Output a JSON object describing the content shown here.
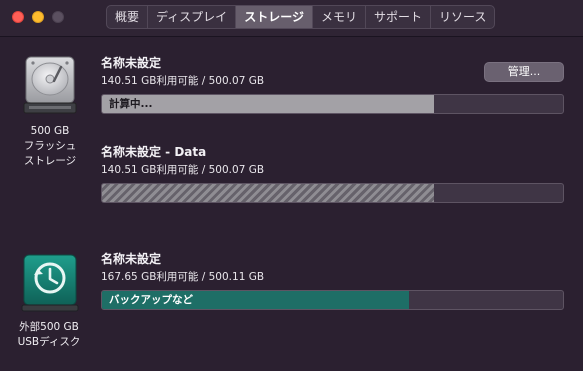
{
  "tabs": [
    "概要",
    "ディスプレイ",
    "ストレージ",
    "メモリ",
    "サポート",
    "リソース"
  ],
  "active_tab": "ストレージ",
  "internal_disk": {
    "caption_lines": [
      "500 GB",
      "フラッシュ",
      "ストレージ"
    ],
    "manage_button": "管理...",
    "volumes": [
      {
        "name": "名称未設定",
        "capacity": "140.51 GB利用可能 / 500.07 GB",
        "bar_label": "計算中...",
        "used_fraction": 0.72
      },
      {
        "name": "名称未設定 - Data",
        "capacity": "140.51 GB利用可能 / 500.07 GB",
        "bar_label": "",
        "used_fraction": 0.72
      }
    ]
  },
  "external_disk": {
    "caption_lines": [
      "外部500 GB",
      "USBディスク"
    ],
    "volumes": [
      {
        "name": "名称未設定",
        "capacity": "167.65 GB利用可能 / 500.11 GB",
        "bar_label": "バックアップなど",
        "used_fraction": 0.665
      }
    ]
  },
  "colors": {
    "background": "#2b2030",
    "bar_used_gray": "#a3a1a6",
    "bar_used_teal": "#1e6e66",
    "bar_free": "#3f3545"
  }
}
